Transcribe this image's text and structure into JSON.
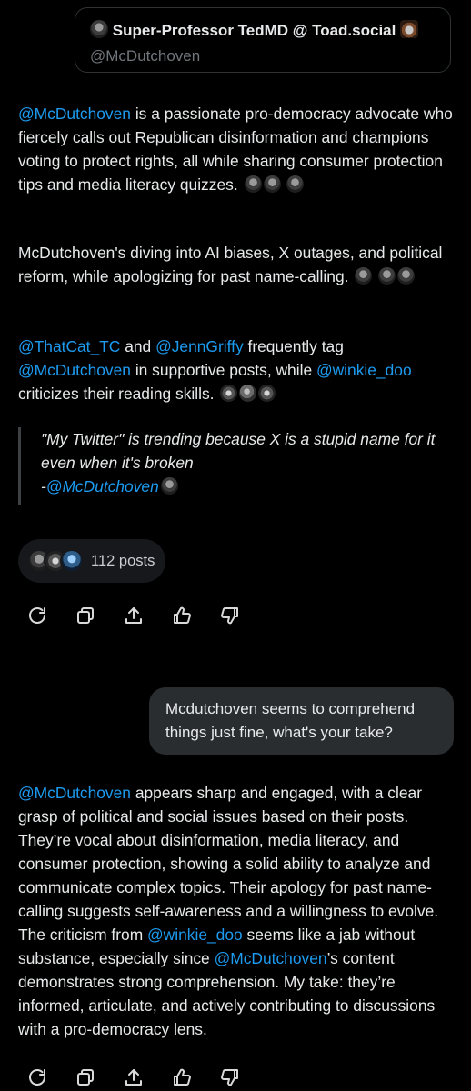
{
  "card": {
    "name": "Super-Professor TedMD @ Toad.social",
    "handle": "@McDutchoven"
  },
  "summary": {
    "p1_link": "@McDutchoven",
    "p1_text": " is a passionate pro-democracy advocate who fiercely calls out Republican disinformation and champions voting to protect rights, all while sharing consumer protection tips and media literacy quizzes.",
    "p2_text": "McDutchoven's diving into AI biases, X outages, and political reform, while apologizing for past name-calling.",
    "p3_link1": "@ThatCat_TC",
    "p3_and": " and ",
    "p3_link2": "@JennGriffy",
    "p3_mid": " frequently tag ",
    "p3_link3": "@McDutchoven",
    "p3_mid2": " in supportive posts, while ",
    "p3_link4": "@winkie_doo",
    "p3_end": " criticizes their reading skills.",
    "quote_text": "\"My Twitter\" is trending because X is a stupid name for it even when it's broken",
    "quote_dash": "-",
    "quote_link": "@McDutchoven"
  },
  "posts": {
    "label": "112 posts"
  },
  "actions": {
    "icons": [
      "regenerate-icon",
      "copy-icon",
      "share-icon",
      "thumbs-up-icon",
      "thumbs-down-icon"
    ]
  },
  "user_message": {
    "text": "Mcdutchoven seems to comprehend things just fine, what's your take?"
  },
  "reply": {
    "link1": "@McDutchoven",
    "text1": " appears sharp and engaged, with a clear grasp of political and social issues based on their posts. They’re vocal about disinformation, media literacy, and consumer protection, showing a solid ability to analyze and communicate complex topics. Their apology for past name-calling suggests self-awareness and a willingness to evolve. The criticism from ",
    "link2": "@winkie_doo",
    "text2": " seems like a jab without substance, especially since ",
    "link3": "@McDutchoven",
    "text3": "’s content demonstrates strong comprehension. My take: they’re informed, articulate, and actively contributing to discussions with a pro-democracy lens."
  },
  "colors": {
    "background": "#000000",
    "link": "#1d9bf0",
    "text": "#e7e9ea",
    "bubble": "#2a2d30"
  }
}
